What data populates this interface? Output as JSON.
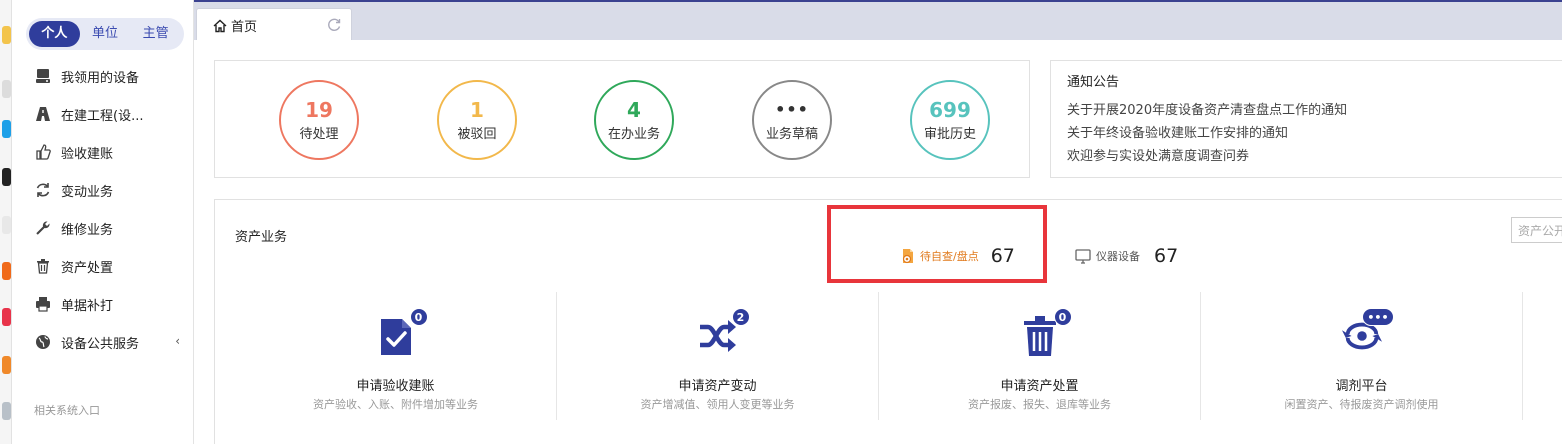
{
  "role_tabs": [
    "个人",
    "单位",
    "主管"
  ],
  "menu": [
    {
      "label": "我领用的设备",
      "icon": "hard-drive-icon"
    },
    {
      "label": "在建工程(设...",
      "icon": "road-icon"
    },
    {
      "label": "验收建账",
      "icon": "thumbs-up-icon"
    },
    {
      "label": "变动业务",
      "icon": "refresh-icon"
    },
    {
      "label": "维修业务",
      "icon": "wrench-icon"
    },
    {
      "label": "资产处置",
      "icon": "trash-icon"
    },
    {
      "label": "单据补打",
      "icon": "printer-icon"
    },
    {
      "label": "设备公共服务",
      "icon": "globe-icon",
      "caret": "‹"
    }
  ],
  "related_label": "相关系统入口",
  "tab": {
    "home_label": "首页"
  },
  "stats": [
    {
      "value": "19",
      "label": "待处理",
      "color": "#ee7760"
    },
    {
      "value": "1",
      "label": "被驳回",
      "color": "#f2b84b"
    },
    {
      "value": "4",
      "label": "在办业务",
      "color": "#2fa85a"
    },
    {
      "value": "•••",
      "label": "业务草稿",
      "color": "#888888"
    },
    {
      "value": "699",
      "label": "审批历史",
      "color": "#57c3bd"
    }
  ],
  "notice": {
    "title": "通知公告",
    "items": [
      "关于开展2020年度设备资产清查盘点工作的通知",
      "关于年终设备验收建账工作安排的通知",
      "欢迎参与实设处满意度调查问券"
    ]
  },
  "asset": {
    "title": "资产业务",
    "pending_label": "待自查/盘点",
    "pending_count": "67",
    "instrument_label": "仪器设备",
    "instrument_count": "67",
    "search_placeholder": "资产公开"
  },
  "actions": [
    {
      "title": "申请验收建账",
      "desc": "资产验收、入账、附件增加等业务",
      "badge": "0",
      "icon": "clipboard-check-icon"
    },
    {
      "title": "申请资产变动",
      "desc": "资产增减值、领用人变更等业务",
      "badge": "2",
      "icon": "shuffle-icon"
    },
    {
      "title": "申请资产处置",
      "desc": "资产报废、报失、退库等业务",
      "badge": "0",
      "icon": "trash-bin-icon"
    },
    {
      "title": "调剂平台",
      "desc": "闲置资产、待报废资产调剂使用",
      "badge": "•••",
      "icon": "exchange-icon"
    }
  ],
  "colors": {
    "primary": "#2f3d9c",
    "highlight": "#e8353b",
    "pending": "#e07a1d"
  }
}
